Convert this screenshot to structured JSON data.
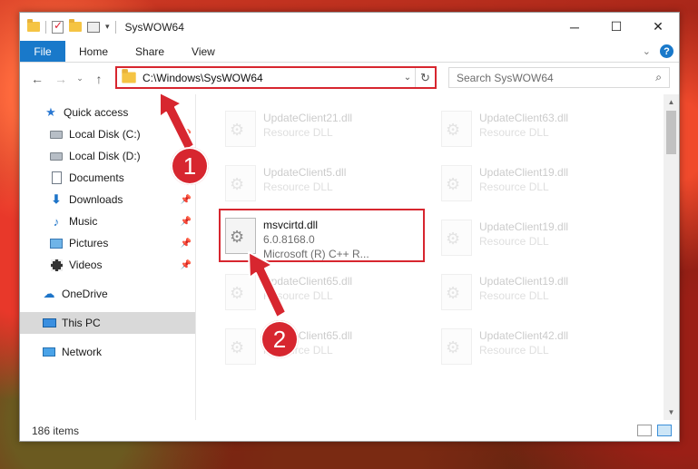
{
  "window": {
    "title": "SysWOW64",
    "controls": {
      "minimize": "─",
      "maximize": "☐",
      "close": "✕"
    }
  },
  "ribbon": {
    "tabs": [
      "File",
      "Home",
      "Share",
      "View"
    ],
    "help": "?"
  },
  "nav": {
    "back": "←",
    "forward": "→",
    "recent": "⌄",
    "up": "↑",
    "address": "C:\\Windows\\SysWOW64",
    "search_placeholder": "Search SysWOW64"
  },
  "sidebar": {
    "items": [
      {
        "label": "Quick access",
        "icon": "star-icon"
      },
      {
        "label": "Local Disk (C:)",
        "icon": "disk-icon",
        "pinned": true
      },
      {
        "label": "Local Disk (D:)",
        "icon": "disk-icon"
      },
      {
        "label": "Documents",
        "icon": "documents-icon",
        "pinned": true
      },
      {
        "label": "Downloads",
        "icon": "downloads-icon",
        "pinned": true
      },
      {
        "label": "Music",
        "icon": "music-icon",
        "pinned": true
      },
      {
        "label": "Pictures",
        "icon": "pictures-icon",
        "pinned": true
      },
      {
        "label": "Videos",
        "icon": "videos-icon",
        "pinned": true
      },
      {
        "label": "OneDrive",
        "icon": "onedrive-icon"
      },
      {
        "label": "This PC",
        "icon": "this-pc-icon",
        "selected": true
      },
      {
        "label": "Network",
        "icon": "network-icon"
      }
    ]
  },
  "files": [
    {
      "name": "UpdateClient21.dll",
      "line2": "Resource DLL",
      "line3": "",
      "faded": true
    },
    {
      "name": "UpdateClient63.dll",
      "line2": "Resource DLL",
      "line3": "",
      "faded": true
    },
    {
      "name": "UpdateClient5.dll",
      "line2": "Resource DLL",
      "line3": "",
      "faded": true
    },
    {
      "name": "UpdateClient19.dll",
      "line2": "Resource DLL",
      "line3": "",
      "faded": true
    },
    {
      "name": "msvcirtd.dll",
      "line2": "6.0.8168.0",
      "line3": "Microsoft (R) C++ R...",
      "faded": false
    },
    {
      "name": "UpdateClient19.dll",
      "line2": "Resource DLL",
      "line3": "",
      "faded": true
    },
    {
      "name": "UpdateClient65.dll",
      "line2": "Resource DLL",
      "line3": "",
      "faded": true
    },
    {
      "name": "UpdateClient19.dll",
      "line2": "Resource DLL",
      "line3": "",
      "faded": true
    },
    {
      "name": "UpdateClient65.dll",
      "line2": "Resource DLL",
      "line3": "",
      "faded": true
    },
    {
      "name": "UpdateClient42.dll",
      "line2": "Resource DLL",
      "line3": "",
      "faded": true
    }
  ],
  "status": {
    "item_count": "186 items"
  },
  "annotations": {
    "step1": "1",
    "step2": "2",
    "color": "#d7262f"
  },
  "colors": {
    "accent": "#1979ca",
    "selection": "#cce8ff"
  }
}
